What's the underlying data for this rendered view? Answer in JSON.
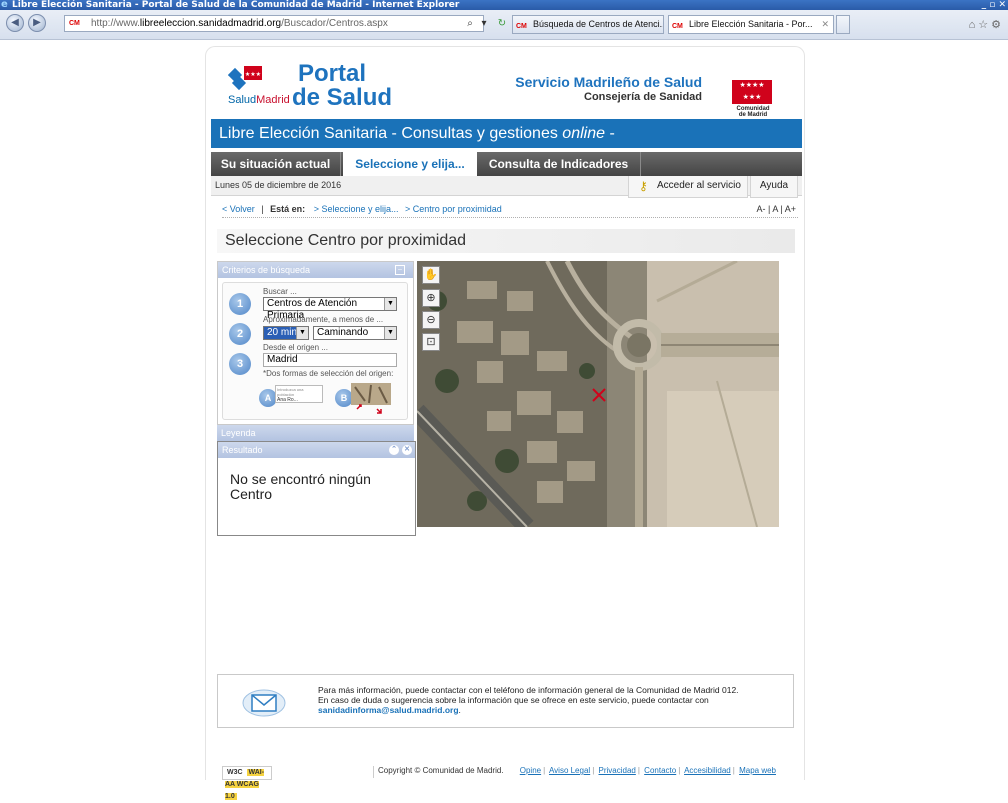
{
  "browser": {
    "window_title": "Libre Elección Sanitaria - Portal de Salud de la Comunidad de Madrid - Internet Explorer",
    "url_prefix": "http://www.",
    "url_host": "libreeleccion.sanidadmadrid.org",
    "url_path": "/Buscador/Centros.aspx",
    "tabs": [
      {
        "label": "Búsqueda de Centros de Atenci...",
        "active": false
      },
      {
        "label": "Libre Elección Sanitaria - Por...",
        "active": true
      }
    ],
    "window_buttons": "_ ▫ ✕"
  },
  "header": {
    "logo_portal": "Portal",
    "logo_de_salud": "de Salud",
    "logo_salud": "Salud",
    "logo_madrid": "Madrid",
    "service_name": "Servicio Madrileño de Salud",
    "department": "Consejería de Sanidad",
    "cm_line1": "Comunidad",
    "cm_line2": "de Madrid",
    "banner_prefix": "Libre Elección Sanitaria - Consultas y gestiones ",
    "banner_italic": "online",
    "banner_suffix": " -"
  },
  "nav": {
    "tabs": [
      "Su situación actual",
      "Seleccione y elija...",
      "Consulta de Indicadores"
    ],
    "date": "Lunes 05 de diciembre de 2016",
    "access_label": "Acceder al servicio",
    "help_label": "Ayuda"
  },
  "breadcrumb": {
    "back": "< Volver",
    "sep": "|",
    "you_are": "Está en:",
    "item1": "> Seleccione y elija...",
    "item2": "> Centro por proximidad",
    "font_sizes": "A- | A | A+"
  },
  "page": {
    "title": "Seleccione Centro por proximidad"
  },
  "criteria": {
    "header": "Criterios de búsqueda",
    "collapse": "–",
    "search_label": "Buscar ...",
    "search_value": "Centros de Atención Primaria",
    "approx_label": "Aproximadamente, a menos de ...",
    "minutes_value": "20 min",
    "mode_value": "Caminando",
    "origin_label": "Desde el origen ...",
    "origin_value": "Madrid",
    "forms_note": "*Dos formas de selección del origen:",
    "option_a": "A",
    "option_b": "B",
    "mini_field_hint": "Introduzca una población",
    "mini_field_value": "Ana Ro..."
  },
  "legend": {
    "header": "Leyenda"
  },
  "result": {
    "header": "Resultado",
    "message": "No se encontró ningún Centro"
  },
  "map_tools": [
    "hand-pan",
    "zoom-in",
    "zoom-out",
    "zoom-box"
  ],
  "footer": {
    "info_line1": "Para más información, puede contactar con el teléfono de información general de la Comunidad de Madrid 012.",
    "info_line2": "En caso de duda o sugerencia sobre la información que se ofrece en este servicio, puede contactar con",
    "info_email": "sanidadinforma@salud.madrid.org",
    "info_end": ".",
    "w3c_prefix": "W3C",
    "w3c_badge": "WAI-AA WCAG 1.0",
    "copyright": "Copyright © Comunidad de Madrid.",
    "links": [
      "Opine",
      "Aviso Legal",
      "Privacidad",
      "Contacto",
      "Accesibilidad",
      "Mapa web"
    ]
  },
  "colors": {
    "brand_blue": "#1a72b8",
    "tab_gray": "#555555",
    "cm_red": "#d0021b"
  }
}
